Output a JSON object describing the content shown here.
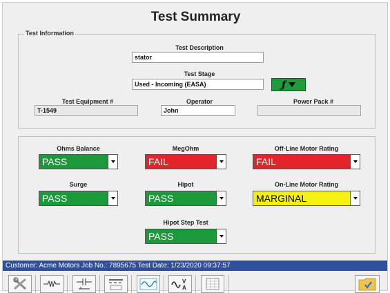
{
  "title": "Test Summary",
  "test_information": {
    "group_label": "Test Information",
    "description_label": "Test Description",
    "description_value": "stator",
    "stage_label": "Test Stage",
    "stage_value": "Used - Incoming (EASA)",
    "equipment_label": "Test Equipment #",
    "equipment_value": "T-1549",
    "operator_label": "Operator",
    "operator_value": "John",
    "power_pack_label": "Power Pack #",
    "power_pack_value": ""
  },
  "results": {
    "ohms_balance": {
      "label": "Ohms Balance",
      "value": "PASS",
      "color": "#1c9a3b"
    },
    "megohm": {
      "label": "MegOhm",
      "value": "FAIL",
      "color": "#e2252b"
    },
    "offline_rating": {
      "label": "Off-Line Motor Rating",
      "value": "FAIL",
      "color": "#e2252b"
    },
    "surge": {
      "label": "Surge",
      "value": "PASS",
      "color": "#1c9a3b"
    },
    "hipot": {
      "label": "Hipot",
      "value": "PASS",
      "color": "#1c9a3b"
    },
    "online_rating": {
      "label": "On-Line Motor Rating",
      "value": "MARGINAL",
      "color": "#f5ef12"
    },
    "hipot_step": {
      "label": "Hipot Step Test",
      "value": "PASS",
      "color": "#1c9a3b"
    }
  },
  "status_bar": {
    "text": "Customer: Acme Motors   Job No.: 7895675   Test Date: 1/23/2020 09:37:57"
  },
  "toolbar": {
    "icons": [
      "tools-icon",
      "resistor-icon",
      "capacitor-icon",
      "dc-meter-icon",
      "waveform-icon",
      "voltage-current-icon",
      "spreadsheet-icon",
      "folder-check-icon"
    ]
  }
}
